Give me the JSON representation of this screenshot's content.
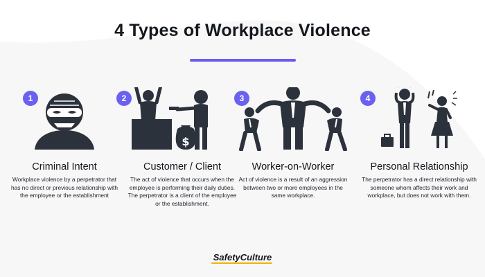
{
  "title": "4 Types of Workplace Violence",
  "accent_color": "#6b61ef",
  "icon_color": "#2b323b",
  "cards": [
    {
      "number": "1",
      "icon": "masked-criminal-icon",
      "title": "Criminal Intent",
      "description": "Workplace violence by a perpetrator that has no direct or previous relationship with the employee or the establishment"
    },
    {
      "number": "2",
      "icon": "customer-robbery-icon",
      "title": "Customer / Client",
      "description": "The act of violence that occurs when the employee is performing their daily duties. The perpetrator is a client of the employee or the establishment."
    },
    {
      "number": "3",
      "icon": "worker-conflict-icon",
      "title": "Worker-on-Worker",
      "description": "Act of violence is a result of an aggression between two or more employees in the same workplace."
    },
    {
      "number": "4",
      "icon": "personal-relationship-icon",
      "title": "Personal Relationship",
      "description": "The perpetrator has a direct relationship with someone whom affects their work and workplace, but does not work with them."
    }
  ],
  "brand": "SafetyCulture"
}
